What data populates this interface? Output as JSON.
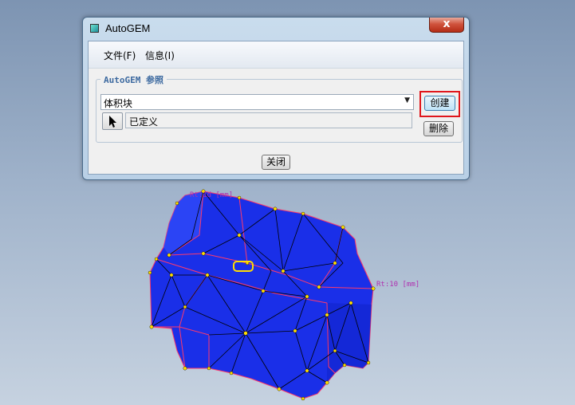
{
  "window": {
    "title": "AutoGEM",
    "close_glyph": "x"
  },
  "menu": {
    "file": "文件(F)",
    "info": "信息(I)"
  },
  "group": {
    "legend": "AutoGEM 参照",
    "select_value": "体积块",
    "status": "已定义"
  },
  "buttons": {
    "create": "创建",
    "delete": "删除",
    "close": "关闭"
  },
  "model": {
    "annotation_top": "Rt:1d [mm]",
    "annotation_right": "Rt:10 [mm]",
    "colors": {
      "body": "#1a2fe8",
      "mesh_edge": "#000000",
      "boundary": "#ff3a6a",
      "node": "#ffdd00"
    }
  },
  "colors": {
    "highlight_box": "#e0161c",
    "accent": "#3d6aa0"
  },
  "icons": {
    "app": "autogem-app-icon",
    "pick": "arrow-cursor-icon",
    "dropdown": "chevron-down-icon"
  }
}
